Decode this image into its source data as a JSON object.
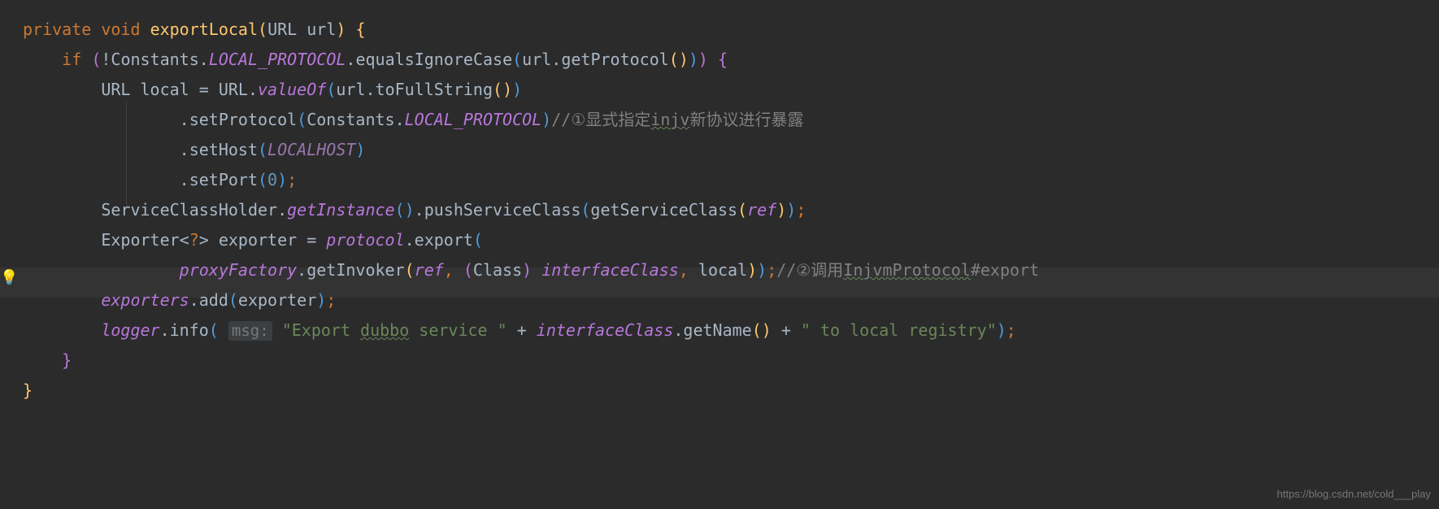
{
  "code": {
    "l1": {
      "private": "private",
      "void": "void",
      "method": "exportLocal",
      "param_type": "URL",
      "param_name": "url"
    },
    "l2": {
      "if": "if",
      "not": "!",
      "constants": "Constants",
      "local_protocol": "LOCAL_PROTOCOL",
      "equalsIgnoreCase": ".equalsIgnoreCase",
      "url": "url",
      "getProtocol": ".getProtocol"
    },
    "l3": {
      "url_type": "URL",
      "local": "local",
      "eq": " = ",
      "url_cls": "URL",
      "valueOf": "valueOf",
      "url_var": "url",
      "toFullString": ".toFullString"
    },
    "l4": {
      "setProtocol": ".setProtocol",
      "constants": "Constants",
      "local_protocol": "LOCAL_PROTOCOL",
      "comment_prefix": "//",
      "comment_num": "①",
      "comment_text1": "显式指定",
      "comment_injv": "injv",
      "comment_text2": "新协议进行暴露"
    },
    "l5": {
      "setHost": ".setHost",
      "localhost": "LOCALHOST"
    },
    "l6": {
      "setPort": ".setPort",
      "zero": "0",
      "semi": ";"
    },
    "l7": {
      "holder": "ServiceClassHolder",
      "getInstance": "getInstance",
      "pushServiceClass": ".pushServiceClass",
      "getServiceClass": "getServiceClass",
      "ref": "ref",
      "semi": ";"
    },
    "l8": {
      "exporter_type": "Exporter",
      "lt": "<",
      "q": "?",
      "gt": ">",
      "exporter_var": "exporter",
      "eq": " = ",
      "protocol": "protocol",
      "export": ".export"
    },
    "l9": {
      "proxyFactory": "proxyFactory",
      "getInvoker": ".getInvoker",
      "ref": "ref",
      "comma1": ",",
      "cast_kw": "Class",
      "interfaceClass": "interfaceClass",
      "comma2": ",",
      "local": "local",
      "semi": ";",
      "comment_prefix": "//",
      "comment_num": "②",
      "comment_text1": "调用",
      "comment_injvm": "InjvmProtocol",
      "comment_hash": "#export"
    },
    "l10": {
      "exporters": "exporters",
      "add": ".add",
      "exporter": "exporter",
      "semi": ";"
    },
    "l11": {
      "logger": "logger",
      "info": ".info",
      "msg_hint": "msg:",
      "s1a": "\"Export ",
      "s1_dubbo": "dubbo",
      "s1b": " service \"",
      "plus1": " + ",
      "interfaceClass": "interfaceClass",
      "getName": ".getName",
      "plus2": " + ",
      "s2": "\" to local registry\"",
      "semi": ";"
    },
    "l12": {
      "brace": "}"
    },
    "l13": {
      "brace": "}"
    }
  },
  "watermark": "https://blog.csdn.net/cold___play"
}
